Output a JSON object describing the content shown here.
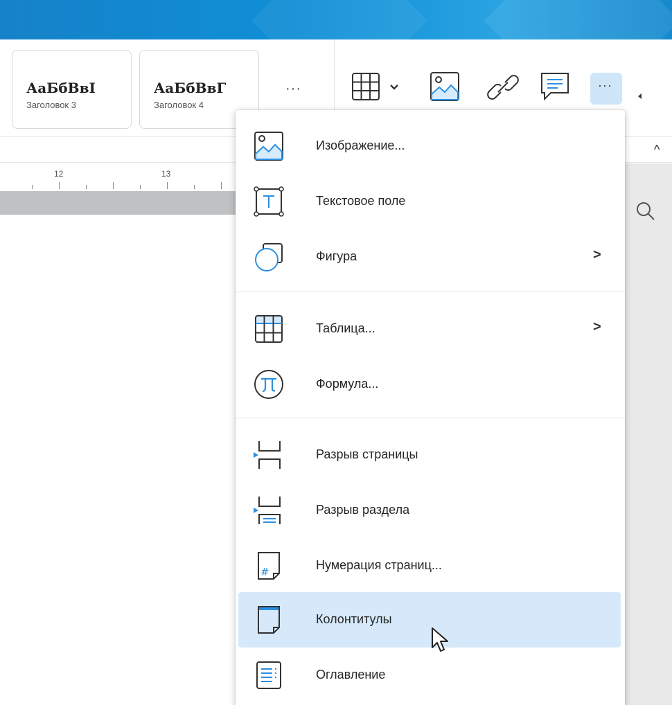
{
  "toolbar": {
    "styles": [
      {
        "sample": "АаБбВвI",
        "name": "Заголовок 3"
      },
      {
        "sample": "АаБбВвГ",
        "name": "Заголовок 4"
      }
    ],
    "styles_more": "···",
    "icons": [
      "table-icon",
      "chevron-down-icon",
      "image-icon",
      "link-icon",
      "comment-icon",
      "more-icon"
    ],
    "more_button": "···",
    "collapse": "^"
  },
  "ruler": {
    "labels": [
      "12",
      "13"
    ]
  },
  "menu": {
    "items": [
      {
        "label": "Изображение...",
        "icon": "image-icon",
        "submenu": false
      },
      {
        "label": "Текстовое поле",
        "icon": "text-box-icon",
        "submenu": false
      },
      {
        "label": "Фигура",
        "icon": "shape-icon",
        "submenu": true
      },
      {
        "label": "Таблица...",
        "icon": "table-icon",
        "submenu": true
      },
      {
        "label": "Формула...",
        "icon": "formula-pi-icon",
        "submenu": false
      },
      {
        "label": "Разрыв страницы",
        "icon": "page-break-icon",
        "submenu": false
      },
      {
        "label": "Разрыв раздела",
        "icon": "section-break-icon",
        "submenu": false
      },
      {
        "label": "Нумерация страниц...",
        "icon": "page-numbering-icon",
        "submenu": false
      },
      {
        "label": "Колонтитулы",
        "icon": "header-footer-icon",
        "submenu": false,
        "highlighted": true
      },
      {
        "label": "Оглавление",
        "icon": "table-of-contents-icon",
        "submenu": false
      }
    ],
    "submenu_arrow": ">"
  },
  "colors": {
    "accent": "#1589d6",
    "icon_blue": "#2b8fe0",
    "highlight": "#d5e9fa",
    "more_button_bg": "#cfe6f9"
  }
}
